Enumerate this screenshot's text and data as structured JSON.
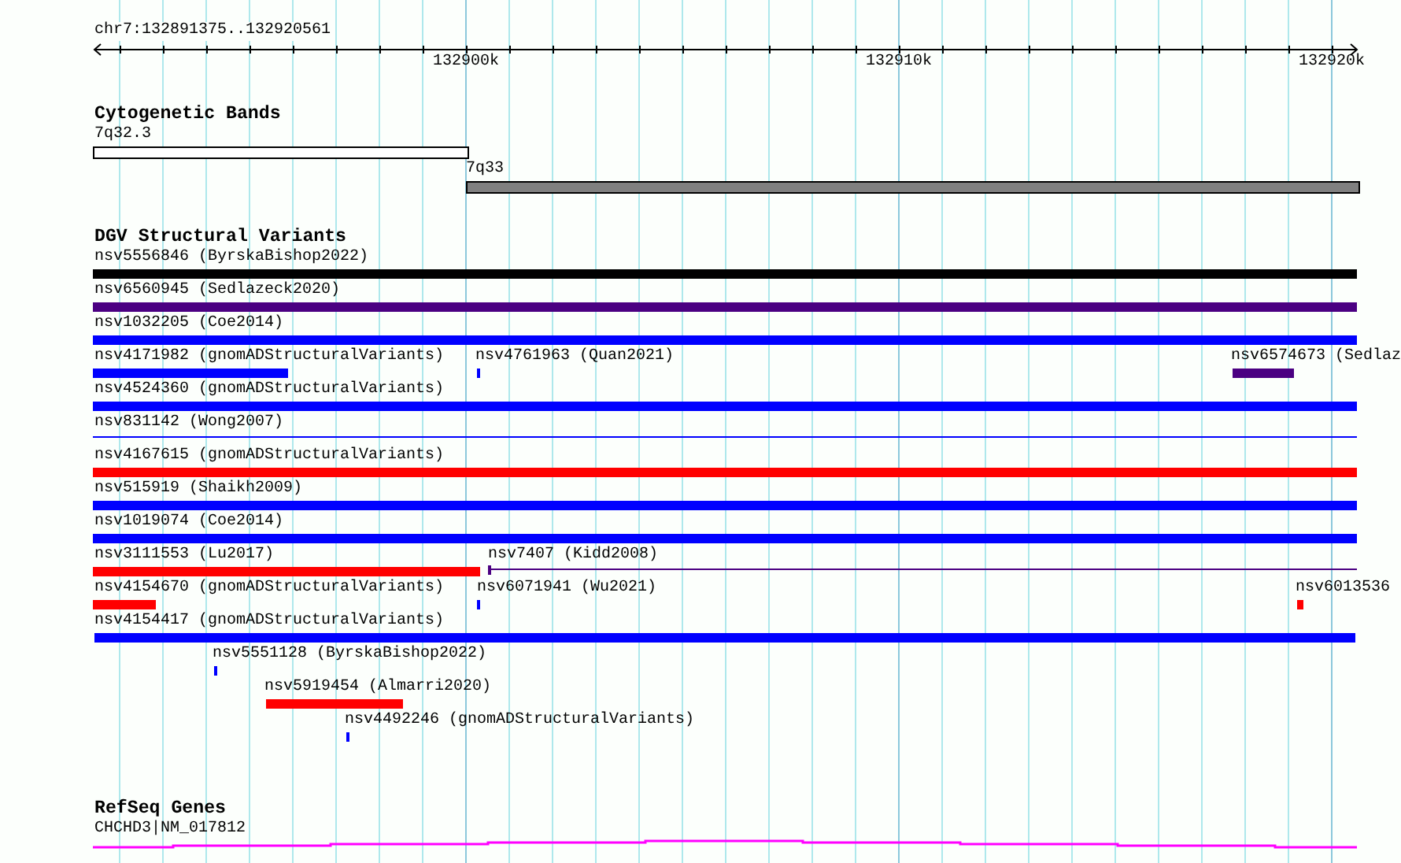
{
  "ruler": {
    "location": "chr7:132891375..132920561",
    "tick_labels": [
      "132900k",
      "132910k",
      "132920k"
    ]
  },
  "cytogenetic_track": {
    "title": "Cytogenetic Bands",
    "bands": [
      {
        "label": "7q32.3",
        "color": "#ffffff"
      },
      {
        "label": "7q33",
        "color": "#808080"
      }
    ]
  },
  "dgv_track": {
    "title": "DGV Structural Variants",
    "rows": [
      [
        {
          "label": "nsv5556846 (ByrskaBishop2022)",
          "kind": "bar",
          "color": "#000000"
        }
      ],
      [
        {
          "label": "nsv6560945 (Sedlazeck2020)",
          "kind": "bar",
          "color": "#4b0082"
        }
      ],
      [
        {
          "label": "nsv1032205 (Coe2014)",
          "kind": "bar",
          "color": "#0000ff"
        }
      ],
      [
        {
          "label": "nsv4171982 (gnomADStructuralVariants)",
          "kind": "bar",
          "color": "#0000ff"
        },
        {
          "label": "nsv4761963 (Quan2021)",
          "kind": "bar",
          "color": "#0000ff"
        },
        {
          "label": "nsv6574673 (Sedlaz",
          "kind": "bar",
          "color": "#4b0082"
        }
      ],
      [
        {
          "label": "nsv4524360 (gnomADStructuralVariants)",
          "kind": "bar",
          "color": "#0000ff"
        }
      ],
      [
        {
          "label": "nsv831142 (Wong2007)",
          "kind": "line",
          "color": "#0000ff"
        }
      ],
      [
        {
          "label": "nsv4167615 (gnomADStructuralVariants)",
          "kind": "bar",
          "color": "#ff0000"
        }
      ],
      [
        {
          "label": "nsv515919 (Shaikh2009)",
          "kind": "bar",
          "color": "#0000ff"
        }
      ],
      [
        {
          "label": "nsv1019074 (Coe2014)",
          "kind": "bar",
          "color": "#0000ff"
        }
      ],
      [
        {
          "label": "nsv3111553 (Lu2017)",
          "kind": "bar",
          "color": "#ff0000"
        },
        {
          "label": "nsv7407 (Kidd2008)",
          "kind": "line",
          "color": "#4b0082"
        }
      ],
      [
        {
          "label": "nsv4154670 (gnomADStructuralVariants)",
          "kind": "bar",
          "color": "#ff0000"
        },
        {
          "label": "nsv6071941 (Wu2021)",
          "kind": "bar",
          "color": "#0000ff"
        },
        {
          "label": "nsv6013536",
          "kind": "bar",
          "color": "#ff0000"
        }
      ],
      [
        {
          "label": "nsv4154417 (gnomADStructuralVariants)",
          "kind": "bar",
          "color": "#0000ff"
        }
      ],
      [
        {
          "label": "nsv5551128 (ByrskaBishop2022)",
          "kind": "bar",
          "color": "#0000ff"
        }
      ],
      [
        {
          "label": "nsv5919454 (Almarri2020)",
          "kind": "bar",
          "color": "#ff0000"
        }
      ],
      [
        {
          "label": "nsv4492246 (gnomADStructuralVariants)",
          "kind": "bar",
          "color": "#0000ff"
        }
      ]
    ]
  },
  "refseq_track": {
    "title": "RefSeq Genes",
    "genes": [
      {
        "label": "CHCHD3|NM_017812"
      }
    ]
  }
}
